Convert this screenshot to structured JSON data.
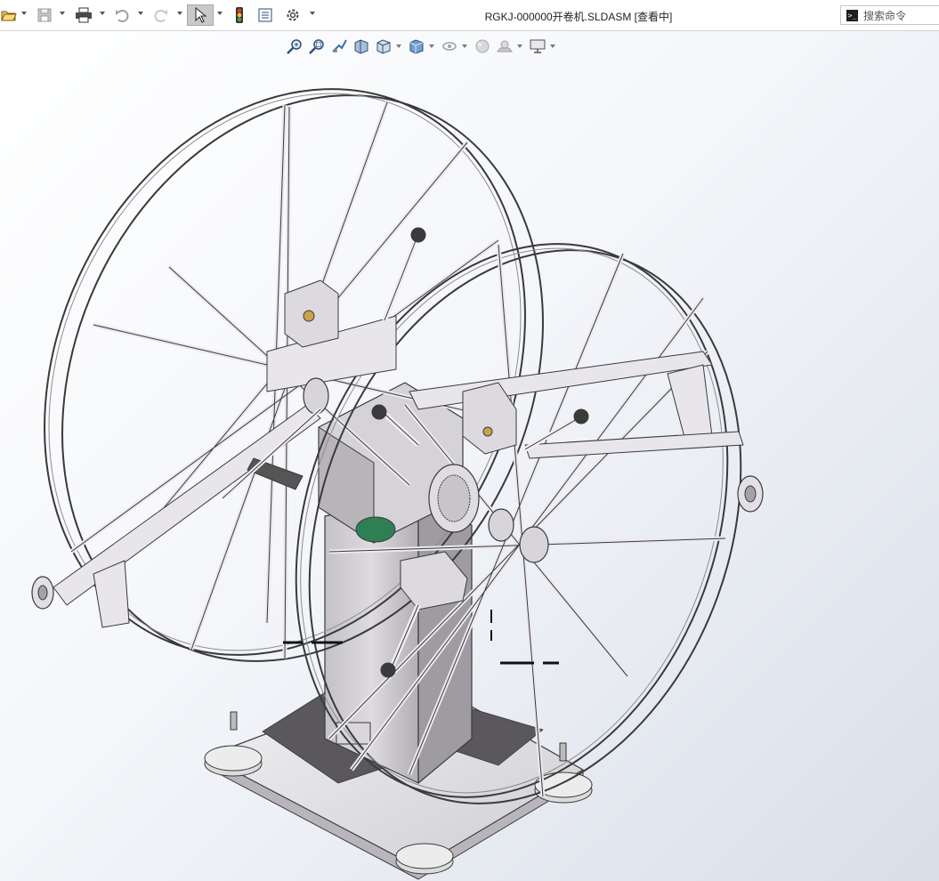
{
  "window": {
    "title": "RGKJ-000000开卷机.SLDASM [查看中]"
  },
  "toolbar": {
    "buttons": [
      {
        "name": "open-document",
        "icon": "open-folder-icon"
      },
      {
        "name": "save",
        "icon": "save-icon"
      },
      {
        "name": "print",
        "icon": "printer-icon"
      },
      {
        "name": "undo",
        "icon": "undo-icon"
      },
      {
        "name": "redo",
        "icon": "redo-icon"
      },
      {
        "name": "select",
        "icon": "cursor-arrow-icon",
        "active": true
      },
      {
        "name": "rebuild",
        "icon": "traffic-light-icon"
      },
      {
        "name": "file-properties",
        "icon": "properties-icon"
      },
      {
        "name": "options",
        "icon": "gear-icon"
      }
    ]
  },
  "search": {
    "placeholder": "搜索命令"
  },
  "heads_up_toolbar": {
    "icons": [
      "zoom-to-fit-icon",
      "zoom-to-area-icon",
      "previous-view-icon",
      "section-view-icon",
      "view-orientation-icon",
      "display-style-icon",
      "hide-show-items-icon",
      "edit-appearance-icon",
      "apply-scene-icon",
      "view-settings-icon"
    ]
  },
  "colors": {
    "viewport_top": "#ffffff",
    "viewport_bottom": "#d9dee8",
    "metal": "#e8e6ea",
    "metal_edge": "#3a3a3a",
    "green_motor": "#2f7f55",
    "select_active": "#c9c9c9",
    "redo_disabled": "#bdbdbd"
  },
  "model": {
    "name": "开卷机 (decoiler) assembly"
  }
}
